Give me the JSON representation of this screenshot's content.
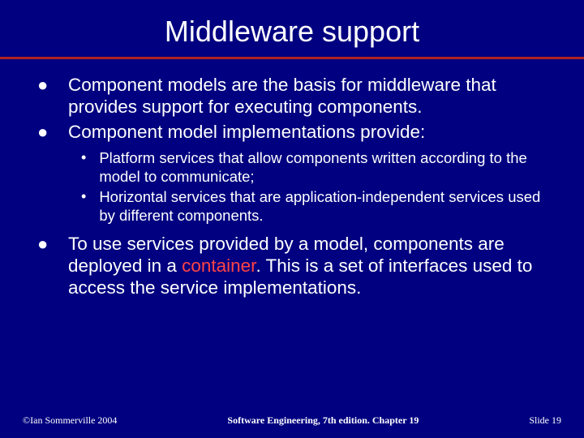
{
  "title": "Middleware support",
  "bullets": {
    "b1": "Component models are the basis for middleware that provides support for executing components.",
    "b2": "Component model implementations provide:",
    "s1": "Platform services that allow components written according to the model to communicate;",
    "s2": "Horizontal services that are application-independent services used by different components.",
    "b3_pre": "To use services provided by a model, components are deployed in a ",
    "b3_hl": "container",
    "b3_post": ". This is a set of interfaces used to access the service implementations."
  },
  "footer": {
    "left": "©Ian Sommerville 2004",
    "center": "Software Engineering, 7th edition. Chapter 19",
    "right": "Slide 19"
  }
}
